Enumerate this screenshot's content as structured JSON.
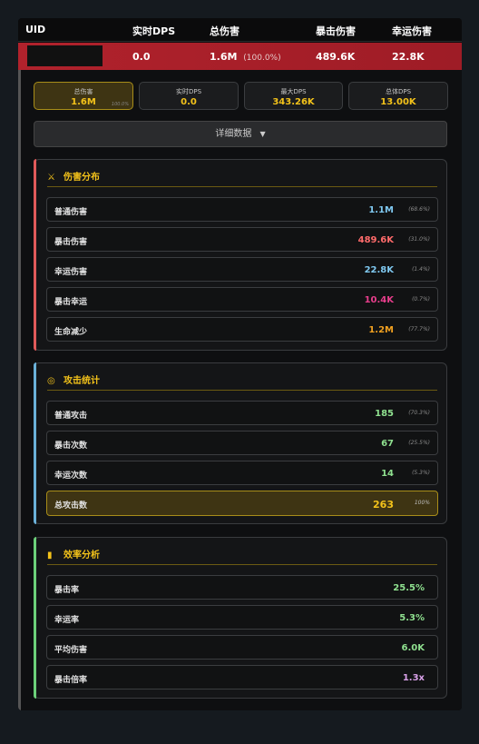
{
  "header": {
    "uid": "UID",
    "realtime_dps": "实时DPS",
    "total_damage": "总伤害",
    "crit_damage": "暴击伤害",
    "lucky_damage": "幸运伤害"
  },
  "player_row": {
    "realtime_dps": "0.0",
    "total_damage": "1.6M",
    "total_pct": "(100.0%)",
    "crit_damage": "489.6K",
    "lucky_damage": "22.8K"
  },
  "stat_cards": [
    {
      "label": "总伤害",
      "value": "1.6M",
      "sub": "100.0%"
    },
    {
      "label": "实时DPS",
      "value": "0.0"
    },
    {
      "label": "最大DPS",
      "value": "343.26K"
    },
    {
      "label": "总体DPS",
      "value": "13.00K"
    }
  ],
  "details_button": {
    "label": "详细数据",
    "arrow": "▼"
  },
  "sections": {
    "damage": {
      "title": "伤害分布",
      "icon": "crossed-swords-icon",
      "accent": "#e05a5a",
      "items": [
        {
          "name": "普通伤害",
          "value": "1.1M",
          "pct": "(68.6%)",
          "color": "#7fc8f0"
        },
        {
          "name": "暴击伤害",
          "value": "489.6K",
          "pct": "(31.0%)",
          "color": "#ff6b6b"
        },
        {
          "name": "幸运伤害",
          "value": "22.8K",
          "pct": "(1.4%)",
          "color": "#7fc8f0"
        },
        {
          "name": "暴击幸运",
          "value": "10.4K",
          "pct": "(0.7%)",
          "color": "#e83e8c"
        },
        {
          "name": "生命减少",
          "value": "1.2M",
          "pct": "(77.7%)",
          "color": "#f0a020"
        }
      ]
    },
    "attack": {
      "title": "攻击统计",
      "icon": "target-icon",
      "accent": "#6ab0d8",
      "items": [
        {
          "name": "普通攻击",
          "value": "185",
          "pct": "(70.3%)",
          "color": "#8fe08f"
        },
        {
          "name": "暴击次数",
          "value": "67",
          "pct": "(25.5%)",
          "color": "#8fe08f"
        },
        {
          "name": "幸运次数",
          "value": "14",
          "pct": "(5.3%)",
          "color": "#8fe08f"
        },
        {
          "name": "总攻击数",
          "value": "263",
          "pct": "100%",
          "color": "#f3c21a"
        }
      ]
    },
    "efficiency": {
      "title": "效率分析",
      "icon": "bar-chart-icon",
      "accent": "#6cd07a",
      "items": [
        {
          "name": "暴击率",
          "value": "25.5%",
          "color": "#8fe08f"
        },
        {
          "name": "幸运率",
          "value": "5.3%",
          "color": "#8fe08f"
        },
        {
          "name": "平均伤害",
          "value": "6.0K",
          "color": "#8fe08f"
        },
        {
          "name": "暴击倍率",
          "value": "1.3x",
          "color": "#d8a0e8"
        }
      ]
    }
  }
}
